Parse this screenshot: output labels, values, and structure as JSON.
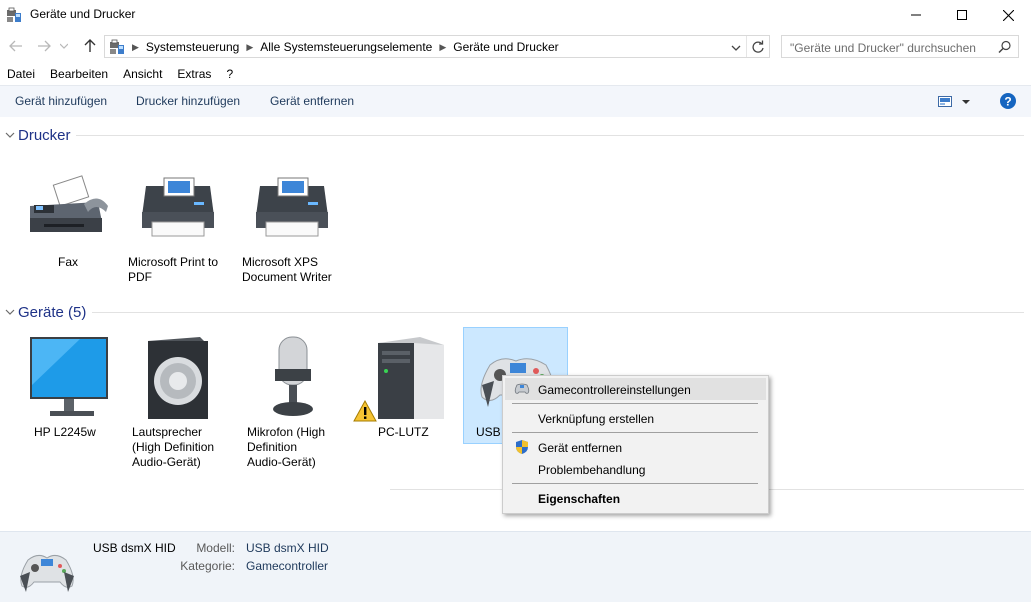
{
  "window": {
    "title": "Geräte und Drucker",
    "app_icon": "devices-printers-icon",
    "controls": [
      "minimize-icon",
      "maximize-icon",
      "close-icon"
    ]
  },
  "address_bar": {
    "breadcrumbs": [
      "Systemsteuerung",
      "Alle Systemsteuerungselemente",
      "Geräte und Drucker"
    ],
    "search_placeholder": "\"Geräte und Drucker\" durchsuchen"
  },
  "menu": [
    "Datei",
    "Bearbeiten",
    "Ansicht",
    "Extras",
    "?"
  ],
  "commands": [
    "Gerät hinzufügen",
    "Drucker hinzufügen",
    "Gerät entfernen"
  ],
  "groups": {
    "printers": {
      "label": "Drucker",
      "items": [
        {
          "name": "Fax",
          "icon": "fax-icon"
        },
        {
          "name": "Microsoft Print to\nPDF",
          "icon": "printer-icon"
        },
        {
          "name": "Microsoft XPS\nDocument Writer",
          "icon": "printer-icon"
        }
      ]
    },
    "devices": {
      "label": "Geräte (5)",
      "items": [
        {
          "name": "HP L2245w",
          "icon": "monitor-icon"
        },
        {
          "name": "Lautsprecher\n(High Definition\nAudio-Gerät)",
          "icon": "speaker-icon"
        },
        {
          "name": "Mikrofon (High\nDefinition\nAudio-Gerät)",
          "icon": "microphone-icon"
        },
        {
          "name": "PC-LUTZ",
          "icon": "computer-tower-icon",
          "badge": "warning-icon"
        },
        {
          "name": "USB",
          "icon": "gamepad-icon",
          "selected": true
        }
      ]
    }
  },
  "context_menu": {
    "items": [
      {
        "label": "Gamecontrollereinstellungen",
        "icon": "gamepad-icon",
        "highlighted": true
      },
      {
        "label": "Verknüpfung erstellen"
      },
      {
        "label": "Gerät entfernen",
        "icon": "uac-shield-icon"
      },
      {
        "label": "Problembehandlung"
      },
      {
        "label": "Eigenschaften",
        "bold": true
      }
    ]
  },
  "details": {
    "device_name": "USB dsmX HID",
    "model_label": "Modell:",
    "model_value": "USB dsmX HID",
    "category_label": "Kategorie:",
    "category_value": "Gamecontroller"
  },
  "colors": {
    "group_header": "#1e3287",
    "command_text": "#1e395b",
    "selection_fill": "#cce8ff",
    "selection_border": "#99d1ff",
    "help_blue": "#1565c0"
  }
}
